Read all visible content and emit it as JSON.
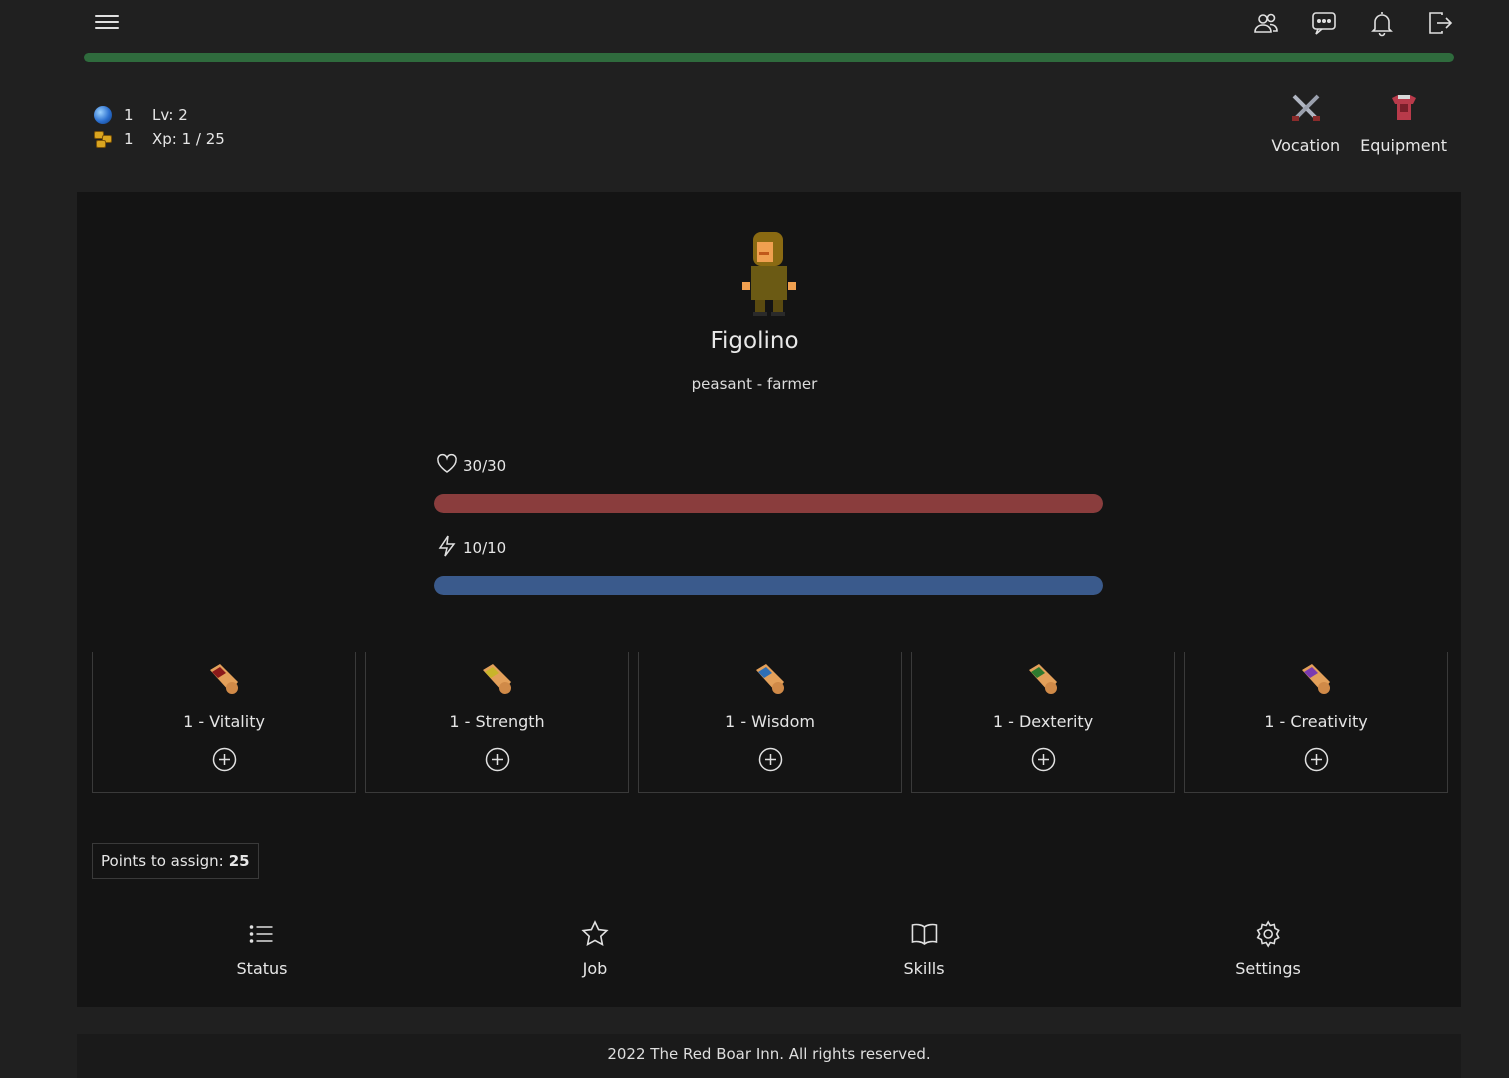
{
  "header": {
    "menu_icon": "hamburger-icon",
    "icons": [
      "users-icon",
      "chat-icon",
      "bell-icon",
      "logout-icon"
    ]
  },
  "progress": {
    "xp_fraction": 1.0,
    "color": "#2f6b3d"
  },
  "resources": {
    "gems": "1",
    "coins": "1",
    "level": "Lv: 2",
    "xp": "Xp: 1 / 25"
  },
  "actions": {
    "vocation": "Vocation",
    "equipment": "Equipment"
  },
  "character": {
    "name": "Figolino",
    "subtitle": "peasant - farmer"
  },
  "bars": {
    "health": {
      "label": "30/30",
      "value": 30,
      "max": 30,
      "color": "#8a3d3d",
      "icon": "heart-icon"
    },
    "energy": {
      "label": "10/10",
      "value": 10,
      "max": 10,
      "color": "#3a5a8c",
      "icon": "lightning-icon"
    }
  },
  "attributes": [
    {
      "label": "1 - Vitality",
      "ribbon": "#8b1a1a"
    },
    {
      "label": "1 - Strength",
      "ribbon": "#c9b52a"
    },
    {
      "label": "1 - Wisdom",
      "ribbon": "#2f6fb5"
    },
    {
      "label": "1 - Dexterity",
      "ribbon": "#2f7a2f"
    },
    {
      "label": "1 - Creativity",
      "ribbon": "#7a3ab0"
    }
  ],
  "points": {
    "label": "Points to assign:",
    "value": "25"
  },
  "nav": {
    "status": "Status",
    "job": "Job",
    "skills": "Skills",
    "settings": "Settings"
  },
  "footer": {
    "text": "2022 The Red Boar Inn. All rights reserved."
  }
}
